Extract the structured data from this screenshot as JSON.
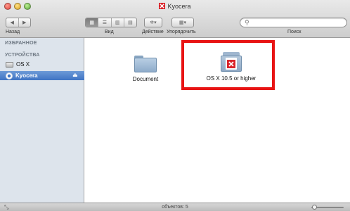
{
  "window": {
    "title": "Kyocera"
  },
  "toolbar": {
    "back_label": "Назад",
    "view_label": "Вид",
    "action_label": "Действие",
    "arrange_label": "Упорядочить",
    "search_label": "Поиск",
    "search_placeholder": "",
    "view_modes": [
      "icon-view",
      "list-view",
      "column-view",
      "coverflow-view"
    ],
    "active_view": "icon-view"
  },
  "sidebar": {
    "favorites_header": "ИЗБРАННОЕ",
    "devices_header": "УСТРОЙСТВА",
    "items": [
      {
        "label": "OS X",
        "icon": "disk-icon",
        "selected": false
      },
      {
        "label": "Kyocera",
        "icon": "cd-icon",
        "selected": true
      }
    ]
  },
  "content": {
    "files": [
      {
        "label": "Document",
        "icon": "folder-icon"
      },
      {
        "label": "OS X 10.5 or higher",
        "icon": "package-icon"
      }
    ]
  },
  "statusbar": {
    "text": "объектов: 5"
  },
  "colors": {
    "highlight": "#e81414",
    "selection": "#3f74c4",
    "kyocera_red": "#d9232a"
  }
}
